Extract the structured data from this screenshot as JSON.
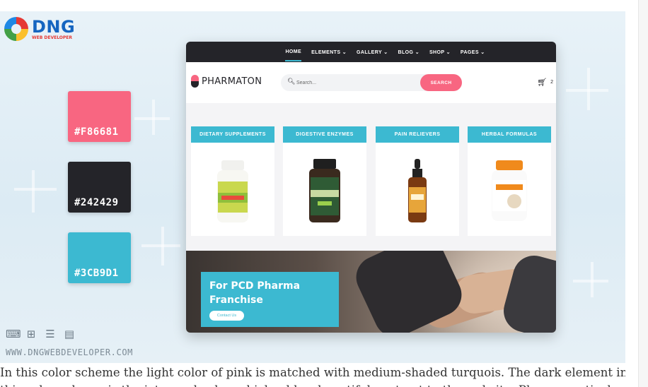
{
  "logo": {
    "name": "DNG",
    "tagline": "WEB DEVELOPER"
  },
  "swatches": [
    {
      "label": "#F86681",
      "color": "#F86681"
    },
    {
      "label": "#242429",
      "color": "#242429"
    },
    {
      "label": "#3CB9D1",
      "color": "#3CB9D1"
    }
  ],
  "tools": [
    "code-window-icon",
    "sitemap-icon",
    "database-icon",
    "document-chart-icon"
  ],
  "site_url": "WWW.DNGWEBDEVELOPER.COM",
  "mockup": {
    "nav": [
      "HOME",
      "ELEMENTS",
      "GALLERY",
      "BLOG",
      "SHOP",
      "PAGES"
    ],
    "nav_dropdown_marker": "⌄",
    "brand": "PHARMATON",
    "search": {
      "placeholder": "Search...",
      "button": "SEARCH"
    },
    "cart": {
      "count": "2"
    },
    "categories": [
      "DIETARY SUPPLEMENTS",
      "DIGESTIVE ENZYMES",
      "PAIN RELIEVERS",
      "HERBAL FORMULAS"
    ],
    "banner": {
      "title": "For PCD Pharma Franchise",
      "button": "Contact Us"
    }
  },
  "paragraph": {
    "line1": "In this color scheme the light color of pink is matched with medium-shaded turquois. The dark element in",
    "line2": "this color scheme is the jet-gray backg, which adds a beautiful contrast to the website. Pharmaceutical"
  },
  "colors": {
    "pink": "#F86681",
    "dark": "#242429",
    "turquoise": "#3CB9D1"
  }
}
